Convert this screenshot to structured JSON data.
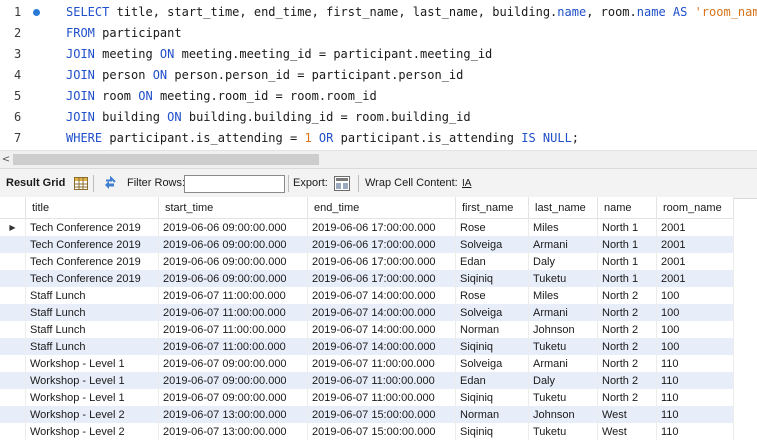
{
  "editor": {
    "lines": [
      {
        "no": "1",
        "segments": [
          {
            "t": "SELECT ",
            "c": "kw"
          },
          {
            "t": "title, start_time, end_time, first_name, last_name, building.",
            "c": ""
          },
          {
            "t": "name",
            "c": "fn"
          },
          {
            "t": ", room.",
            "c": ""
          },
          {
            "t": "name",
            "c": "fn"
          },
          {
            "t": " AS ",
            "c": "kw"
          },
          {
            "t": "'room_name'",
            "c": "str"
          }
        ]
      },
      {
        "no": "2",
        "segments": [
          {
            "t": "FROM ",
            "c": "kw"
          },
          {
            "t": "participant",
            "c": ""
          }
        ]
      },
      {
        "no": "3",
        "segments": [
          {
            "t": "JOIN ",
            "c": "kw"
          },
          {
            "t": "meeting ",
            "c": ""
          },
          {
            "t": "ON ",
            "c": "kw"
          },
          {
            "t": "meeting.meeting_id = participant.meeting_id",
            "c": ""
          }
        ]
      },
      {
        "no": "4",
        "segments": [
          {
            "t": "JOIN ",
            "c": "kw"
          },
          {
            "t": "person ",
            "c": ""
          },
          {
            "t": "ON ",
            "c": "kw"
          },
          {
            "t": "person.person_id = participant.person_id",
            "c": ""
          }
        ]
      },
      {
        "no": "5",
        "segments": [
          {
            "t": "JOIN ",
            "c": "kw"
          },
          {
            "t": "room ",
            "c": ""
          },
          {
            "t": "ON ",
            "c": "kw"
          },
          {
            "t": "meeting.room_id = room.room_id",
            "c": ""
          }
        ]
      },
      {
        "no": "6",
        "segments": [
          {
            "t": "JOIN ",
            "c": "kw"
          },
          {
            "t": "building ",
            "c": ""
          },
          {
            "t": "ON ",
            "c": "kw"
          },
          {
            "t": "building.building_id = room.building_id",
            "c": ""
          }
        ]
      },
      {
        "no": "7",
        "segments": [
          {
            "t": "WHERE ",
            "c": "kw"
          },
          {
            "t": "participant.is_attending = ",
            "c": ""
          },
          {
            "t": "1",
            "c": "num"
          },
          {
            "t": " ",
            "c": ""
          },
          {
            "t": "OR ",
            "c": "kw"
          },
          {
            "t": "participant.is_attending ",
            "c": ""
          },
          {
            "t": "IS NULL",
            "c": "kw"
          },
          {
            "t": ";",
            "c": ""
          }
        ]
      }
    ]
  },
  "scrollbar": {
    "left_arrow": "<"
  },
  "toolbar": {
    "result_grid_label": "Result Grid",
    "filter_rows_label": "Filter Rows:",
    "filter_value": "",
    "export_label": "Export:",
    "wrap_label": "Wrap Cell Content:",
    "wrap_icon_glyph": "IA"
  },
  "grid": {
    "columns": [
      "title",
      "start_time",
      "end_time",
      "first_name",
      "last_name",
      "name",
      "room_name"
    ],
    "current_row_marker": "▶",
    "rows": [
      [
        "Tech Conference 2019",
        "2019-06-06 09:00:00.000",
        "2019-06-06 17:00:00.000",
        "Rose",
        "Miles",
        "North 1",
        "2001"
      ],
      [
        "Tech Conference 2019",
        "2019-06-06 09:00:00.000",
        "2019-06-06 17:00:00.000",
        "Solveiga",
        "Armani",
        "North 1",
        "2001"
      ],
      [
        "Tech Conference 2019",
        "2019-06-06 09:00:00.000",
        "2019-06-06 17:00:00.000",
        "Edan",
        "Daly",
        "North 1",
        "2001"
      ],
      [
        "Tech Conference 2019",
        "2019-06-06 09:00:00.000",
        "2019-06-06 17:00:00.000",
        "Siqiniq",
        "Tuketu",
        "North 1",
        "2001"
      ],
      [
        "Staff Lunch",
        "2019-06-07 11:00:00.000",
        "2019-06-07 14:00:00.000",
        "Rose",
        "Miles",
        "North 2",
        "100"
      ],
      [
        "Staff Lunch",
        "2019-06-07 11:00:00.000",
        "2019-06-07 14:00:00.000",
        "Solveiga",
        "Armani",
        "North 2",
        "100"
      ],
      [
        "Staff Lunch",
        "2019-06-07 11:00:00.000",
        "2019-06-07 14:00:00.000",
        "Norman",
        "Johnson",
        "North 2",
        "100"
      ],
      [
        "Staff Lunch",
        "2019-06-07 11:00:00.000",
        "2019-06-07 14:00:00.000",
        "Siqiniq",
        "Tuketu",
        "North 2",
        "100"
      ],
      [
        "Workshop - Level 1",
        "2019-06-07 09:00:00.000",
        "2019-06-07 11:00:00.000",
        "Solveiga",
        "Armani",
        "North 2",
        "110"
      ],
      [
        "Workshop - Level 1",
        "2019-06-07 09:00:00.000",
        "2019-06-07 11:00:00.000",
        "Edan",
        "Daly",
        "North 2",
        "110"
      ],
      [
        "Workshop - Level 1",
        "2019-06-07 09:00:00.000",
        "2019-06-07 11:00:00.000",
        "Siqiniq",
        "Tuketu",
        "North 2",
        "110"
      ],
      [
        "Workshop - Level 2",
        "2019-06-07 13:00:00.000",
        "2019-06-07 15:00:00.000",
        "Norman",
        "Johnson",
        "West",
        "110"
      ],
      [
        "Workshop - Level 2",
        "2019-06-07 13:00:00.000",
        "2019-06-07 15:00:00.000",
        "Siqiniq",
        "Tuketu",
        "West",
        "110"
      ]
    ]
  }
}
